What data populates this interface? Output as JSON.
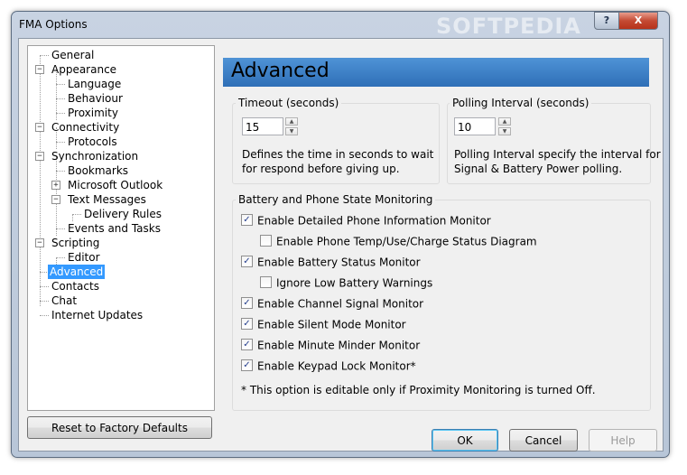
{
  "window": {
    "title": "FMA Options",
    "watermark": "SOFTPEDIA",
    "help_glyph": "?",
    "close_glyph": "X"
  },
  "tree": {
    "items": [
      {
        "label": "General"
      },
      {
        "label": "Appearance",
        "expander": "−"
      },
      {
        "label": "Language"
      },
      {
        "label": "Behaviour"
      },
      {
        "label": "Proximity"
      },
      {
        "label": "Connectivity",
        "expander": "−"
      },
      {
        "label": "Protocols"
      },
      {
        "label": "Synchronization",
        "expander": "−"
      },
      {
        "label": "Bookmarks"
      },
      {
        "label": "Microsoft Outlook",
        "expander": "+"
      },
      {
        "label": "Text Messages",
        "expander": "−"
      },
      {
        "label": "Delivery Rules"
      },
      {
        "label": "Events and Tasks"
      },
      {
        "label": "Scripting",
        "expander": "−"
      },
      {
        "label": "Editor"
      },
      {
        "label": "Advanced",
        "selected": true
      },
      {
        "label": "Contacts"
      },
      {
        "label": "Chat"
      },
      {
        "label": "Internet Updates"
      }
    ]
  },
  "panel": {
    "header": "Advanced",
    "timeout": {
      "label": "Timeout (seconds)",
      "value": "15",
      "desc_line1": "Defines the time in seconds to wait",
      "desc_line2": "for respond before giving up."
    },
    "polling": {
      "label": "Polling Interval (seconds)",
      "value": "10",
      "desc_line1": "Polling Interval specify the interval for",
      "desc_line2": "Signal & Battery Power polling."
    },
    "monitoring": {
      "label": "Battery and Phone State Monitoring",
      "options": [
        {
          "label": "Enable Detailed Phone Information Monitor",
          "checked": true
        },
        {
          "label": "Enable Phone Temp/Use/Charge Status Diagram",
          "checked": false
        },
        {
          "label": "Enable Battery Status Monitor",
          "checked": true
        },
        {
          "label": "Ignore Low Battery Warnings",
          "checked": false
        },
        {
          "label": "Enable Channel Signal Monitor",
          "checked": true
        },
        {
          "label": "Enable Silent Mode Monitor",
          "checked": true
        },
        {
          "label": "Enable Minute Minder Monitor",
          "checked": true
        },
        {
          "label": "Enable Keypad Lock Monitor*",
          "checked": true
        }
      ],
      "note": "* This option is editable only if Proximity Monitoring is turned Off."
    }
  },
  "buttons": {
    "reset": "Reset to Factory Defaults",
    "ok": "OK",
    "cancel": "Cancel",
    "help": "Help"
  },
  "colors": {
    "header_bg": "#3f82c8",
    "selection": "#3399ff"
  }
}
